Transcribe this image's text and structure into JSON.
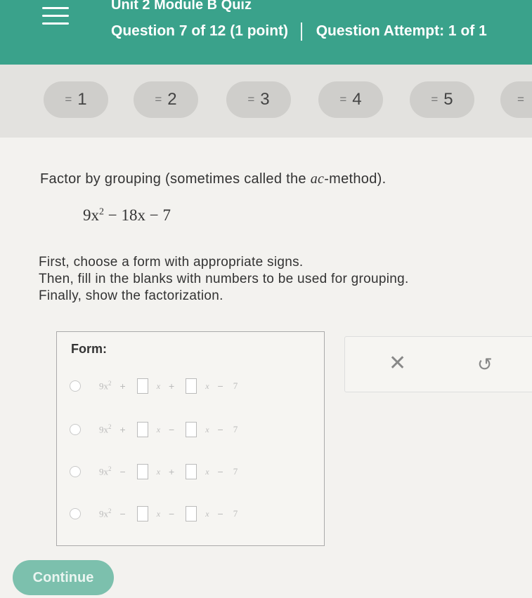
{
  "header": {
    "quiz_title": "Unit 2 Module B Quiz",
    "question_label": "Question 7 of 12",
    "points": "(1 point)",
    "attempt": "Question Attempt: 1 of 1"
  },
  "nav": {
    "buttons": [
      "1",
      "2",
      "3",
      "4",
      "5"
    ]
  },
  "problem": {
    "prompt_before": "Factor by grouping (sometimes called the ",
    "prompt_italic": "ac",
    "prompt_after": "-method).",
    "expr_lead": "9x",
    "expr_exp": "2",
    "expr_tail": " − 18x − 7",
    "instructions": [
      "First, choose a form with appropriate signs.",
      "Then, fill in the blanks with numbers to be used for grouping.",
      "Finally, show the factorization."
    ]
  },
  "form": {
    "label": "Form:",
    "lead_term": "9x",
    "lead_exp": "2",
    "var": "x",
    "const_sign": "−",
    "const": "7",
    "options": [
      {
        "op1": "+",
        "op2": "+"
      },
      {
        "op1": "+",
        "op2": "−"
      },
      {
        "op1": "−",
        "op2": "+"
      },
      {
        "op1": "−",
        "op2": "−"
      }
    ]
  },
  "tools": {
    "clear_symbol": "✕",
    "undo_symbol": "↺"
  },
  "continue_label": "Continue",
  "colors": {
    "header": "#3aa28b",
    "continue": "#7cc0ad"
  }
}
